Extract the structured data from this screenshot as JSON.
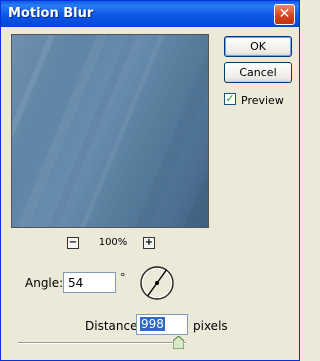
{
  "window": {
    "title": "Motion Blur",
    "close_glyph": "✕"
  },
  "preview": {
    "zoom_out": "−",
    "zoom_in": "+",
    "zoom_level": "100%"
  },
  "buttons": {
    "ok": "OK",
    "cancel": "Cancel"
  },
  "preview_toggle": {
    "label": "Preview",
    "checked": true,
    "check_glyph": "✓"
  },
  "angle": {
    "label": "Angle:",
    "value": "54",
    "unit": "°"
  },
  "distance": {
    "label": "Distance:",
    "value": "998",
    "unit": "pixels"
  },
  "colors": {
    "title_bar": "#0a5ee8",
    "dialog_bg": "#ece9d8",
    "preview_blue": "#5f84a5",
    "selection": "#316ac5"
  }
}
